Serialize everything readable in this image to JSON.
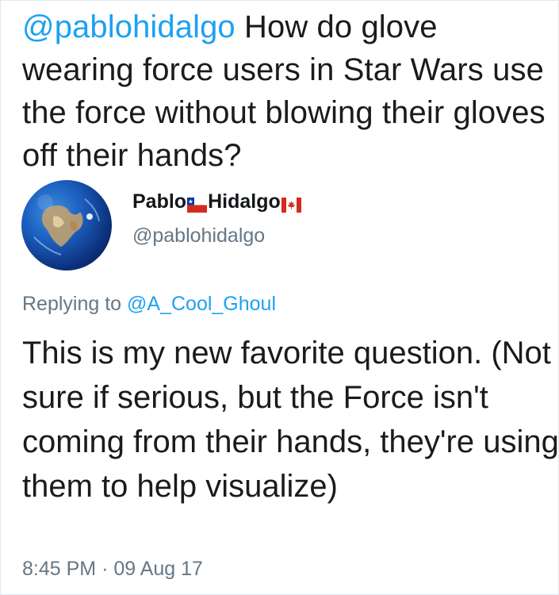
{
  "quoted_tweet": {
    "mention": "@pablohidalgo",
    "text": "How do glove wearing force users in Star Wars use the force without blowing their gloves off their hands?"
  },
  "author": {
    "first_name": "Pablo",
    "last_name": "Hidalgo",
    "handle": "@pablohidalgo",
    "flag_1": "chile-flag-icon",
    "flag_2": "canada-flag-icon"
  },
  "replying": {
    "prefix": "Replying to",
    "mention": "@A_Cool_Ghoul"
  },
  "reply": {
    "text": "This is my new favorite question. (Not sure if serious, but the Force isn't coming from their hands, they're using them to help visualize)"
  },
  "timestamp": {
    "time": "8:45 PM",
    "separator": "·",
    "date": "09 Aug 17"
  },
  "colors": {
    "link": "#1da1f2",
    "muted": "#657786",
    "text": "#14171a"
  }
}
